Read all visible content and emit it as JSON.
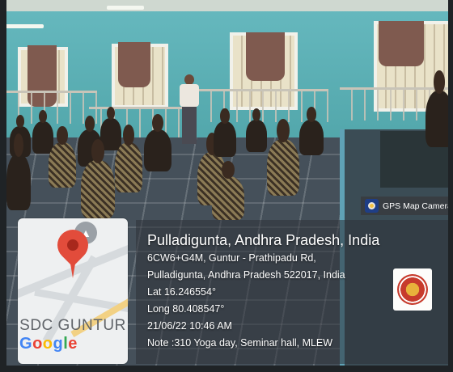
{
  "gps_overlay": {
    "app_label": "GPS Map Camera",
    "place_title": "Pulladigunta, Andhra Pradesh, India",
    "address_line_1": "6CW6+G4M, Guntur - Prathipadu Rd,",
    "address_line_2": "Pulladigunta, Andhra Pradesh 522017, India",
    "latitude": "Lat 16.246554°",
    "longitude": "Long 80.408547°",
    "datetime": "21/06/22 10:46 AM",
    "note": "Note :310 Yoga day, Seminar hall, MLEW"
  },
  "map_thumbnail": {
    "location_label": "SDC GUNTUR",
    "brand": "Google",
    "brand_colors": [
      "#4285F4",
      "#EA4335",
      "#FBBC05",
      "#4285F4",
      "#34A853",
      "#EA4335"
    ],
    "pin_color": "#E24C3B"
  },
  "icons": [
    "gps-camera-icon",
    "map-pin-icon",
    "graduation-cap-icon",
    "college-seal-logo"
  ]
}
